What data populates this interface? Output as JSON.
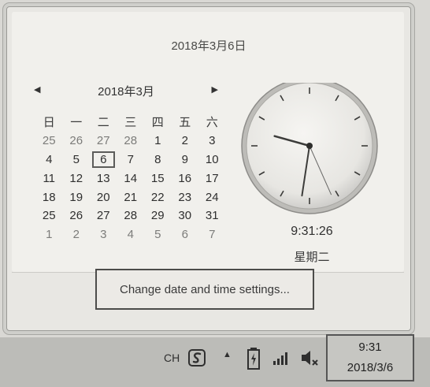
{
  "popup": {
    "full_date": "2018年3月6日",
    "calendar": {
      "prev_icon": "triangle-left",
      "next_icon": "triangle-right",
      "month_label": "2018年3月",
      "weekdays": [
        "日",
        "一",
        "二",
        "三",
        "四",
        "五",
        "六"
      ],
      "weeks": [
        [
          "25",
          "26",
          "27",
          "28",
          "1",
          "2",
          "3"
        ],
        [
          "4",
          "5",
          "6",
          "7",
          "8",
          "9",
          "10"
        ],
        [
          "11",
          "12",
          "13",
          "14",
          "15",
          "16",
          "17"
        ],
        [
          "18",
          "19",
          "20",
          "21",
          "22",
          "23",
          "24"
        ],
        [
          "25",
          "26",
          "27",
          "28",
          "29",
          "30",
          "31"
        ],
        [
          "1",
          "2",
          "3",
          "4",
          "5",
          "6",
          "7"
        ]
      ],
      "today": "6"
    },
    "clock": {
      "time": "9:31:26",
      "weekday": "星期二"
    },
    "settings_link": "Change date and time settings..."
  },
  "taskbar": {
    "input_language": "CH",
    "ime_icon": "sogou-s-icon",
    "show_hidden_icon": "triangle-up",
    "battery_icon": "battery-charging",
    "signal_icon": "signal-bars",
    "volume_icon": "speaker-muted",
    "time": "9:31",
    "date": "2018/3/6"
  }
}
